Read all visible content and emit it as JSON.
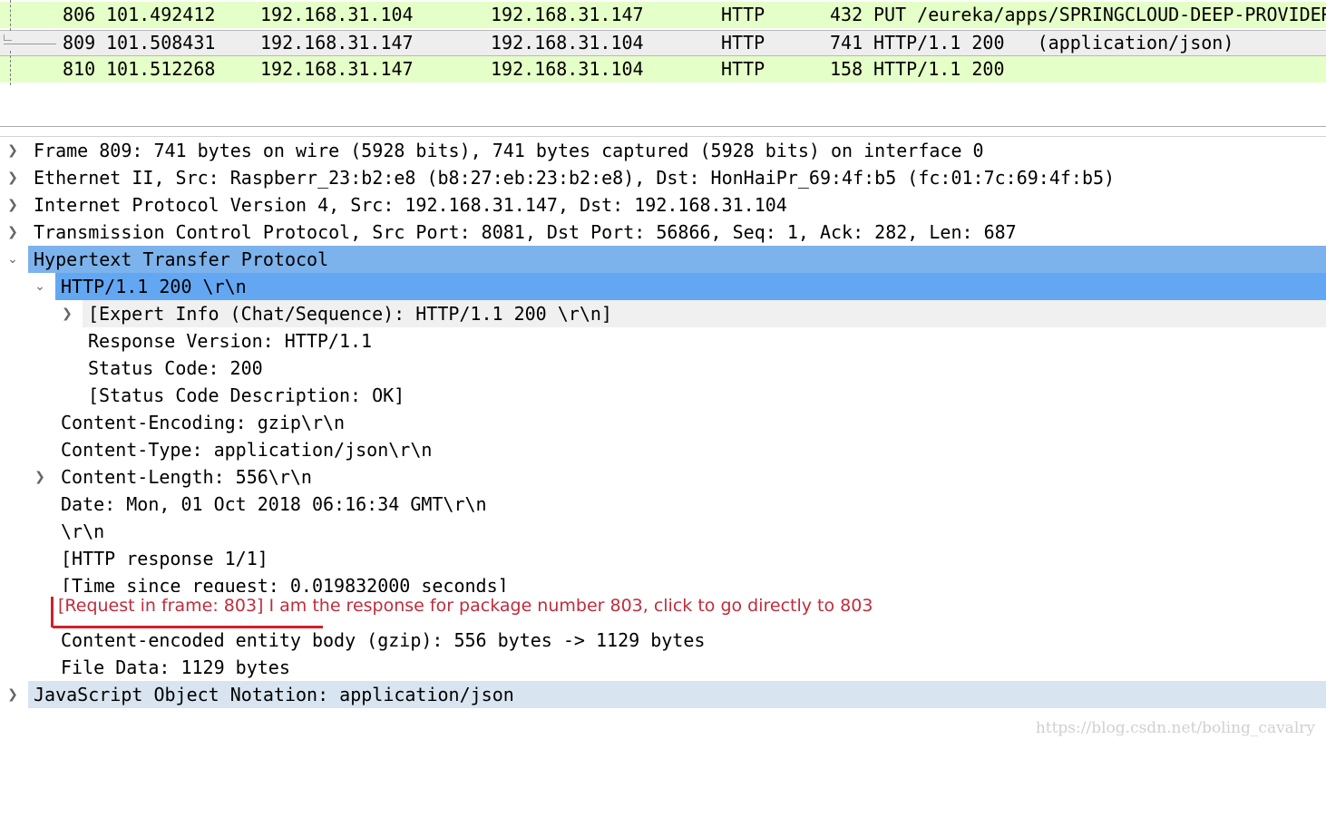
{
  "packet_list": {
    "rows": [
      {
        "no": "806",
        "time": "101.492412",
        "src": "192.168.31.104",
        "dst": "192.168.31.147",
        "proto": "HTTP",
        "len": "432",
        "info": "PUT /eureka/apps/SPRINGCLOUD-DEEP-PROVIDER"
      },
      {
        "no": "809",
        "time": "101.508431",
        "src": "192.168.31.147",
        "dst": "192.168.31.104",
        "proto": "HTTP",
        "len": "741",
        "info": "HTTP/1.1 200   (application/json)"
      },
      {
        "no": "810",
        "time": "101.512268",
        "src": "192.168.31.147",
        "dst": "192.168.31.104",
        "proto": "HTTP",
        "len": "158",
        "info": "HTTP/1.1 200"
      }
    ],
    "row_color": "#e4ffc7",
    "selected_color": "#eeeeee"
  },
  "detail_tree": {
    "frame": "Frame 809: 741 bytes on wire (5928 bits), 741 bytes captured (5928 bits) on interface 0",
    "ethernet": "Ethernet II, Src: Raspberr_23:b2:e8 (b8:27:eb:23:b2:e8), Dst: HonHaiPr_69:4f:b5 (fc:01:7c:69:4f:b5)",
    "ip": "Internet Protocol Version 4, Src: 192.168.31.147, Dst: 192.168.31.104",
    "tcp": "Transmission Control Protocol, Src Port: 8081, Dst Port: 56866, Seq: 1, Ack: 282, Len: 687",
    "http": "Hypertext Transfer Protocol",
    "status_line": "HTTP/1.1 200 \\r\\n",
    "expert_info": "[Expert Info (Chat/Sequence): HTTP/1.1 200 \\r\\n]",
    "response_version": "Response Version: HTTP/1.1",
    "status_code": "Status Code: 200",
    "status_desc": "[Status Code Description: OK]",
    "content_encoding": "Content-Encoding: gzip\\r\\n",
    "content_type": "Content-Type: application/json\\r\\n",
    "content_length": "Content-Length: 556\\r\\n",
    "date": "Date: Mon, 01 Oct 2018 06:16:34 GMT\\r\\n",
    "crlf": "\\r\\n",
    "http_response": "[HTTP response 1/1]",
    "time_since": "[Time since request: 0.019832000 seconds]",
    "content_encoded": "Content-encoded entity body (gzip): 556 bytes -> 1129 bytes",
    "file_data": "File Data: 1129 bytes",
    "json": "JavaScript Object Notation: application/json"
  },
  "annotation": {
    "text": "[Request in frame: 803] I am the response for package number 803, click to go directly to 803",
    "color": "#bf2d3c"
  },
  "watermark": "https://blog.csdn.net/boling_cavalry",
  "colors": {
    "selected_parent": "#7db3ec",
    "selected_child": "#63a7f2",
    "json_row": "#d8e5f0"
  }
}
